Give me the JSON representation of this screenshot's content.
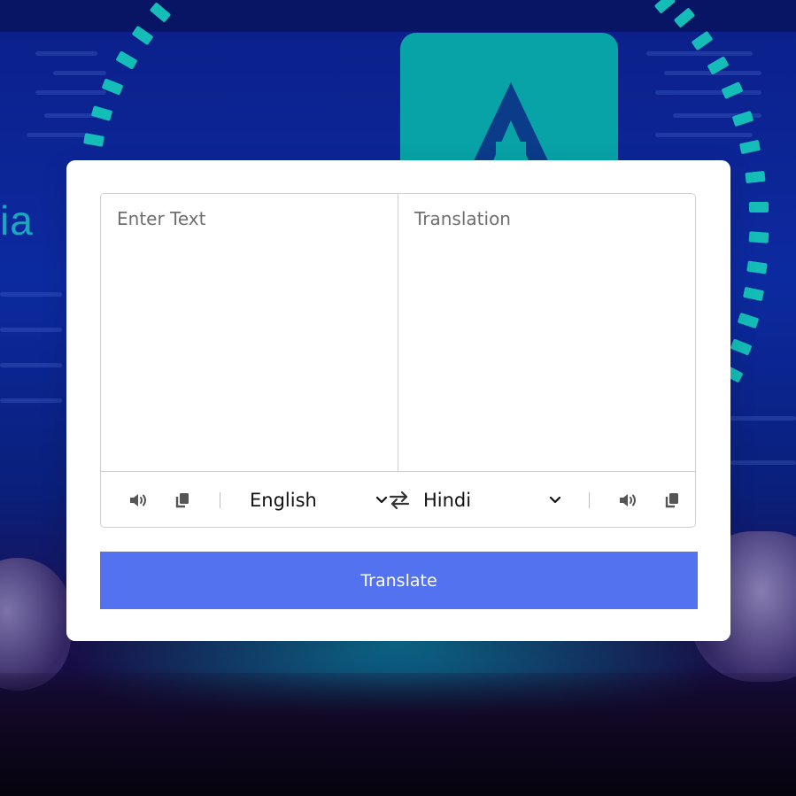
{
  "from_panel": {
    "placeholder": "Enter Text",
    "language": "English"
  },
  "to_panel": {
    "placeholder": "Translation",
    "language": "Hindi"
  },
  "controls": {
    "from_speak_icon": "volume-icon",
    "from_copy_icon": "copy-icon",
    "exchange_icon": "exchange-arrows-icon",
    "to_speak_icon": "volume-icon",
    "to_copy_icon": "copy-icon"
  },
  "translate_button": {
    "label": "Translate"
  },
  "background": {
    "brand_text": "ia"
  },
  "colors": {
    "accent": "#5372f0",
    "card": "#ffffff",
    "border": "#cfcfcf"
  }
}
